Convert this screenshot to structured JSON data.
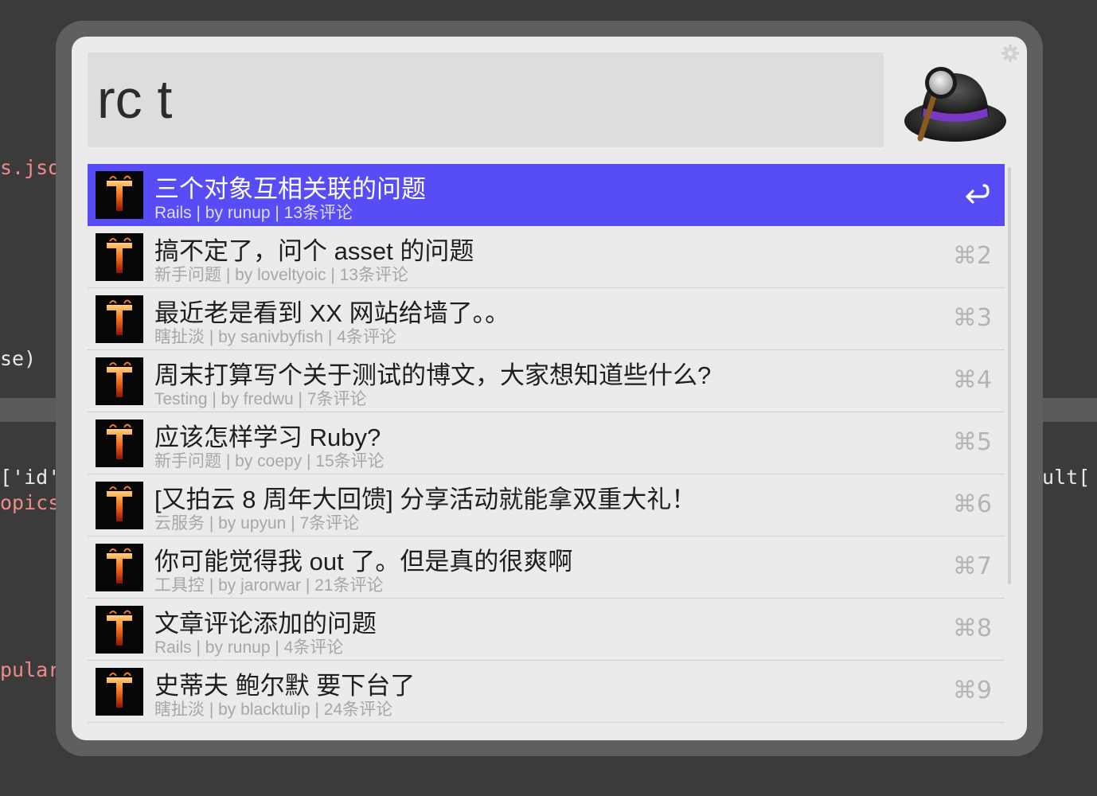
{
  "background_code": {
    "line1": "s.json",
    "line2": "se)",
    "line3": "['id']",
    "line4": "opics/",
    "line5": "pular\"",
    "line6": "sult["
  },
  "search": {
    "query": "rc t"
  },
  "colors": {
    "selection": "#574cf6",
    "panel": "#ebebeb",
    "frame": "#5f5f5f"
  },
  "results": [
    {
      "title": "三个对象互相关联的问题",
      "subtitle": "Rails | by runup | 13条评论",
      "action": "enter-icon",
      "selected": true
    },
    {
      "title": "搞不定了，问个 asset 的问题",
      "subtitle": "新手问题 | by loveltyoic | 13条评论",
      "shortcut": "⌘2"
    },
    {
      "title": "最近老是看到 XX 网站给墙了。。",
      "subtitle": "瞎扯淡 | by sanivbyfish | 4条评论",
      "shortcut": "⌘3"
    },
    {
      "title": "周末打算写个关于测试的博文，大家想知道些什么?",
      "subtitle": "Testing | by fredwu | 7条评论",
      "shortcut": "⌘4"
    },
    {
      "title": "应该怎样学习 Ruby?",
      "subtitle": "新手问题 | by coepy | 15条评论",
      "shortcut": "⌘5"
    },
    {
      "title": "[又拍云 8 周年大回馈] 分享活动就能拿双重大礼！",
      "subtitle": "云服务 | by upyun | 7条评论",
      "shortcut": "⌘6"
    },
    {
      "title": "你可能觉得我 out 了。但是真的很爽啊",
      "subtitle": "工具控 | by jarorwar | 21条评论",
      "shortcut": "⌘7"
    },
    {
      "title": "文章评论添加的问题",
      "subtitle": "Rails | by runup | 4条评论",
      "shortcut": "⌘8"
    },
    {
      "title": "史蒂夫 鲍尔默 要下台了",
      "subtitle": "瞎扯淡 | by blacktulip | 24条评论",
      "shortcut": "⌘9"
    }
  ]
}
